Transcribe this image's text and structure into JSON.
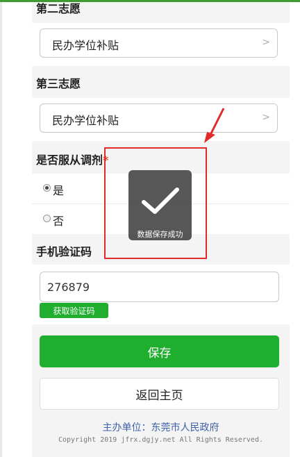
{
  "form": {
    "second_choice_label": "第二志愿",
    "second_choice_value": "民办学位补贴",
    "third_choice_label": "第三志愿",
    "third_choice_value": "民办学位补贴",
    "adjust_label": "是否服从调剂",
    "required_mark": "*",
    "adjust_options": [
      {
        "label": "是",
        "checked": true
      },
      {
        "label": "否",
        "checked": false
      }
    ],
    "sms_label": "手机验证码",
    "sms_value": "276879",
    "get_code_label": "获取验证码",
    "save_label": "保存",
    "home_label": "返回主页"
  },
  "footer": {
    "sponsor": "主办单位：东莞市人民政府",
    "copyright": "Copyright 2019 jfrx.dgjy.net All Rights Reserved."
  },
  "toast": {
    "message": "数据保存成功",
    "icon": "check-icon"
  },
  "colors": {
    "primary": "#1fae2e",
    "annotation": "#e42b2b",
    "link": "#3f62a8"
  }
}
